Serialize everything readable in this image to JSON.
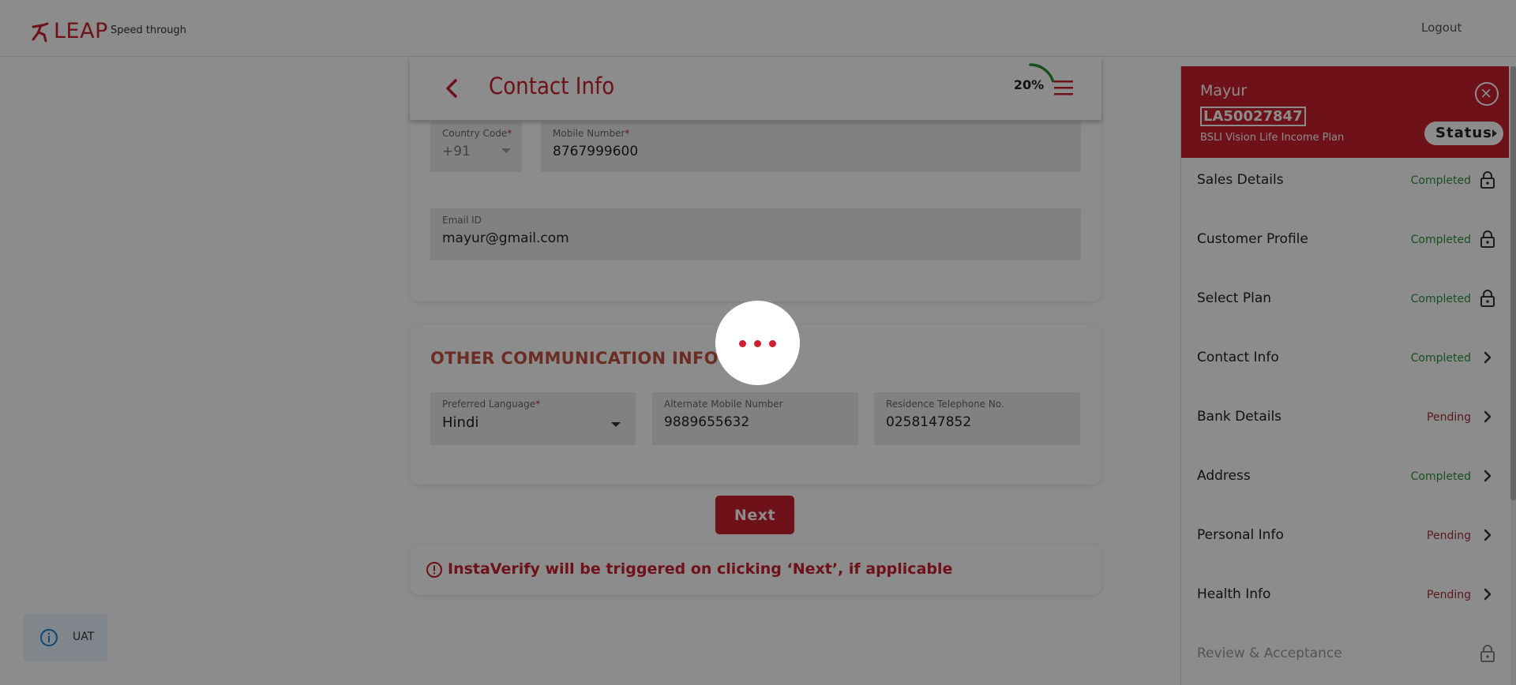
{
  "header": {
    "logo_text": "LEAP",
    "tagline": "Speed through",
    "logout_label": "Logout"
  },
  "page": {
    "title": "Contact Info",
    "progress_text": "20%",
    "progress_value": 0.2
  },
  "contact": {
    "country_code_label": "Country Code",
    "country_code_value": "+91",
    "mobile_label": "Mobile Number",
    "mobile_value": "8767999600",
    "email_label": "Email ID",
    "email_value": "mayur@gmail.com"
  },
  "other_comm": {
    "title": "OTHER COMMUNICATION INFO",
    "language_label": "Preferred Language",
    "language_value": "Hindi",
    "alt_mobile_label": "Alternate Mobile Number",
    "alt_mobile_value": "9889655632",
    "residence_label": "Residence Telephone No.",
    "residence_value": "0258147852"
  },
  "next_label": "Next",
  "notice_text": "InstaVerify will be triggered on clicking ‘Next’, if applicable",
  "uat_label": "UAT",
  "sidebar": {
    "name": "Mayur",
    "application_id": "LA50027847",
    "plan": "BSLI Vision Life Income Plan",
    "status_label": "Status",
    "steps": [
      {
        "label": "Sales Details",
        "status": "Completed",
        "icon": "lock-icon"
      },
      {
        "label": "Customer Profile",
        "status": "Completed",
        "icon": "lock-icon"
      },
      {
        "label": "Select Plan",
        "status": "Completed",
        "icon": "lock-icon"
      },
      {
        "label": "Contact Info",
        "status": "Completed",
        "icon": "chevron-right-icon"
      },
      {
        "label": "Bank Details",
        "status": "Pending",
        "icon": "chevron-right-icon"
      },
      {
        "label": "Address",
        "status": "Completed",
        "icon": "chevron-right-icon"
      },
      {
        "label": "Personal Info",
        "status": "Pending",
        "icon": "chevron-right-icon"
      },
      {
        "label": "Health Info",
        "status": "Pending",
        "icon": "chevron-right-icon"
      },
      {
        "label": "Review & Acceptance",
        "status": "",
        "icon": "lock-icon"
      }
    ]
  },
  "colors": {
    "brand": "#c8202f",
    "completed": "#2f8f3f",
    "pending": "#a0303a",
    "section_title": "#c45340"
  }
}
